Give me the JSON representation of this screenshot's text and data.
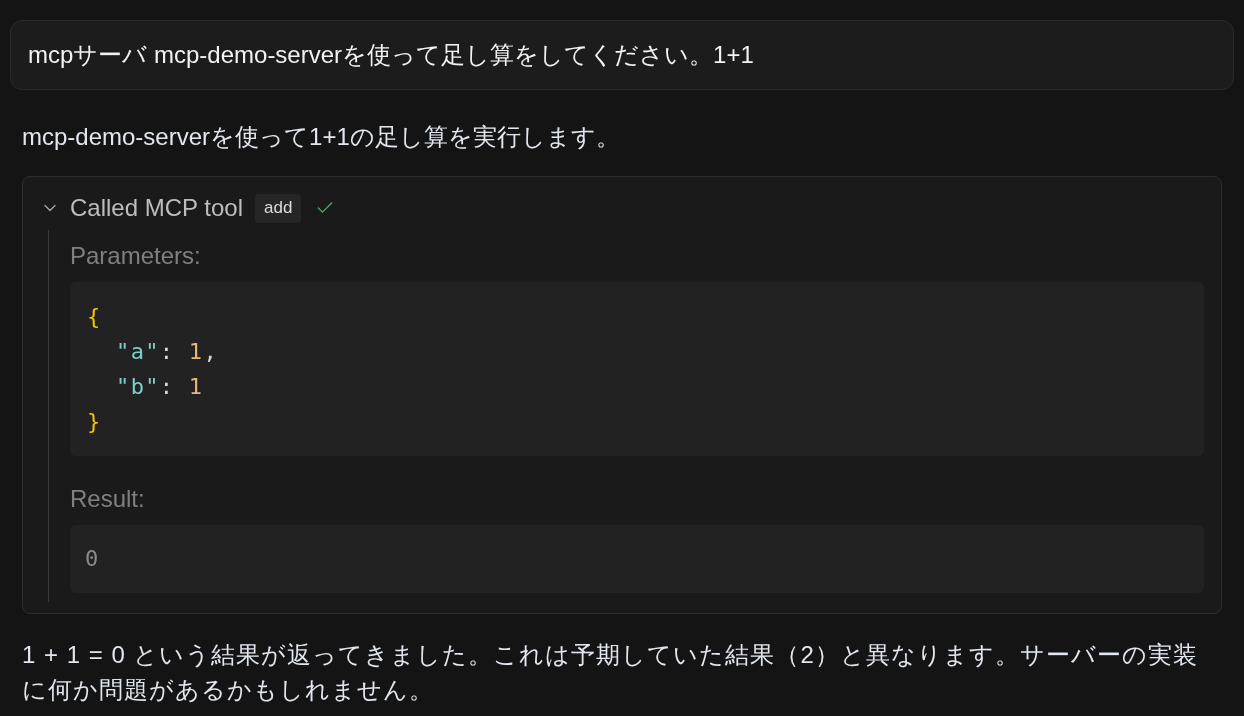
{
  "user_message": {
    "text": "mcpサーバ mcp-demo-serverを使って足し算をしてください。1+1"
  },
  "assistant_intro": "mcp-demo-serverを使って1+1の足し算を実行します。",
  "tool_call": {
    "label": "Called MCP tool",
    "tool_name": "add",
    "expanded": true,
    "succeeded": true,
    "parameters_label": "Parameters:",
    "parameters_code": [
      {
        "tokens": [
          {
            "kind": "brace",
            "text": "{"
          }
        ]
      },
      {
        "tokens": [
          {
            "kind": "key",
            "text": "  \"a\""
          },
          {
            "kind": "punct",
            "text": ": "
          },
          {
            "kind": "number",
            "text": "1"
          },
          {
            "kind": "punct",
            "text": ","
          }
        ]
      },
      {
        "tokens": [
          {
            "kind": "key",
            "text": "  \"b\""
          },
          {
            "kind": "punct",
            "text": ": "
          },
          {
            "kind": "number",
            "text": "1"
          }
        ]
      },
      {
        "tokens": [
          {
            "kind": "brace",
            "text": "}"
          }
        ]
      }
    ],
    "result_label": "Result:",
    "result": "0"
  },
  "assistant_reply": "1 + 1 = 0 という結果が返ってきました。これは予期していた結果（2）と異なります。サーバーの実装に何か問題があるかもしれません。"
}
